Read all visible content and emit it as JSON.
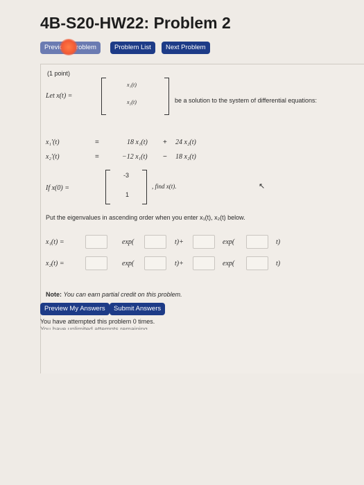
{
  "page": {
    "title": "4B-S20-HW22: Problem 2"
  },
  "nav": {
    "previous": "Previous Problem",
    "list": "Problem List",
    "next": "Next Problem"
  },
  "problem": {
    "points": "(1 point)",
    "let_prefix": "Let x(t) =",
    "vec_x1": "x₁(t)",
    "vec_x2": "x₂(t)",
    "be_solution": "be a solution to the system of differential equations:",
    "eq1_lhs": "x₁′(t)",
    "eq1_eq": "=",
    "eq1_rhs1": "18 x₁(t)",
    "eq1_op": "+",
    "eq1_rhs2": "24 x₂(t)",
    "eq2_lhs": "x₂′(t)",
    "eq2_eq": "=",
    "eq2_rhs1": "−12 x₁(t)",
    "eq2_op": "−",
    "eq2_rhs2": "18 x₂(t)",
    "if_prefix": "If x(0) =",
    "x0_top": "-3",
    "x0_bottom": "1",
    "find": ", find x(t).",
    "instructions": "Put the eigenvalues in ascending order when you enter x₁(t), x₂(t) below.",
    "x1_label": "x₁(t) =",
    "x2_label": "x₂(t) =",
    "exp": "exp(",
    "t_plus": "t)+",
    "t_close": "t)",
    "note_bold": "Note:",
    "note": "You can earn partial credit on this problem."
  },
  "actions": {
    "preview": "Preview My Answers",
    "submit": "Submit Answers"
  },
  "status": {
    "attempts": "You have attempted this problem 0 times.",
    "cut_off": "You have unlimited attempts remaining."
  },
  "colors": {
    "button": "#1d3b87",
    "glare": "#f25a35"
  }
}
